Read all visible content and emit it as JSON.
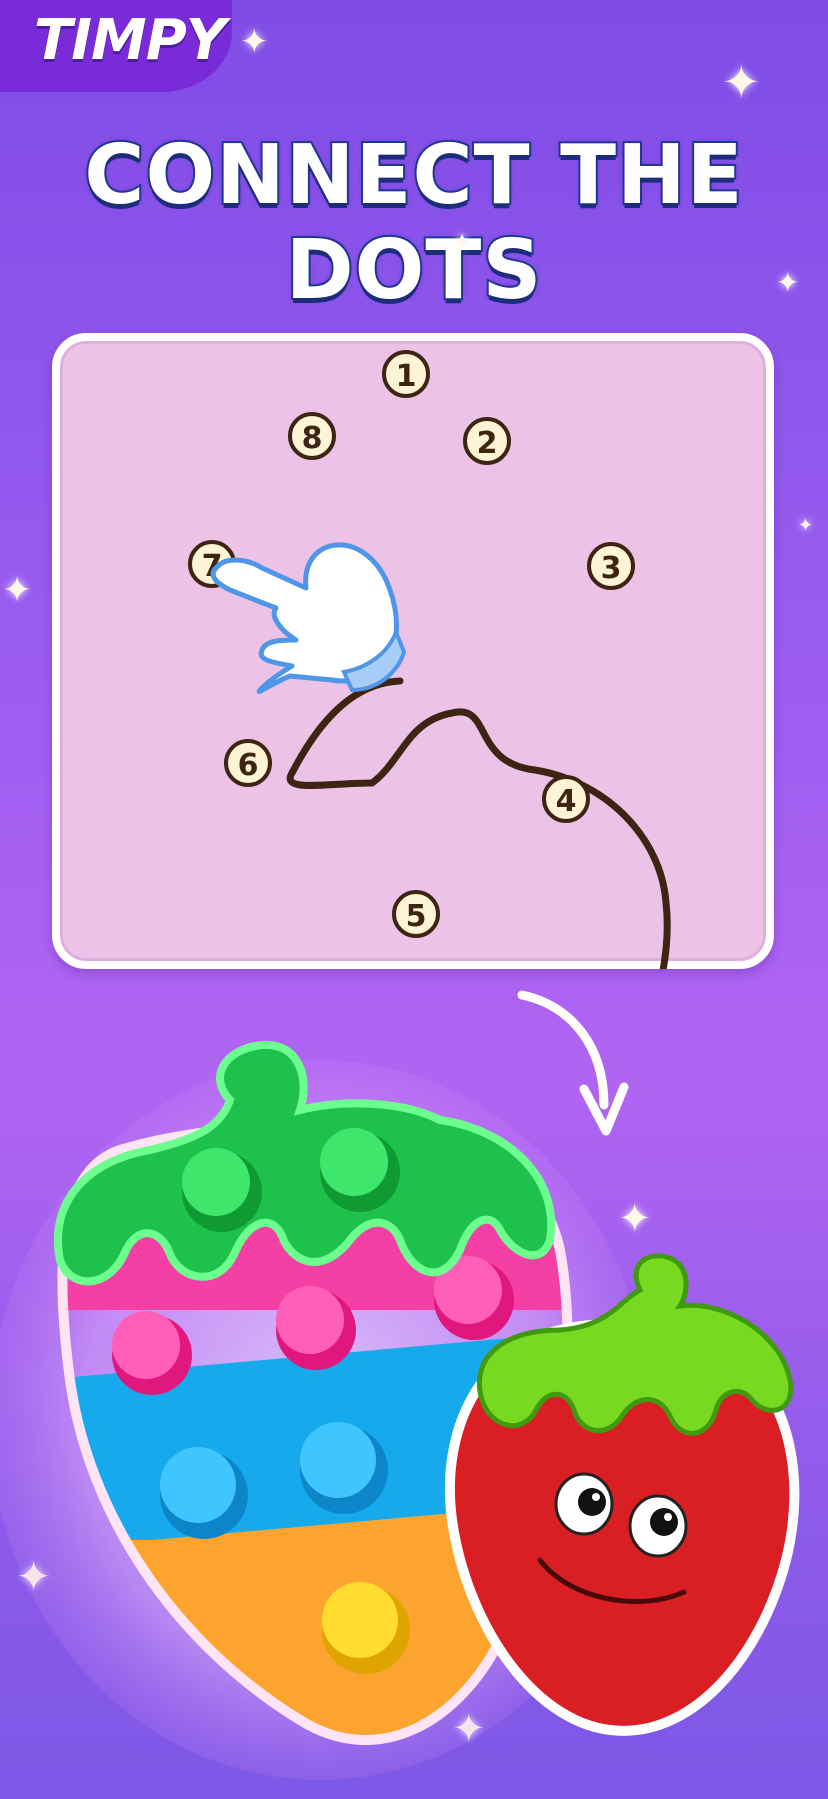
{
  "app": {
    "logo_text": "TIMPY"
  },
  "headline": "CONNECT THE DOTS",
  "puzzle": {
    "dots": [
      "1",
      "2",
      "3",
      "4",
      "5",
      "6",
      "7",
      "8"
    ]
  },
  "colors": {
    "background": "#9a5cf0",
    "title_outline": "#233a99",
    "panel_fill": "#ecc2e7",
    "line": "#3e2412",
    "dot_fill": "#fdf4d6"
  },
  "icons": [
    "hand-pointer-icon",
    "curved-arrow-icon",
    "sparkle-icon",
    "strawberry-popit-icon",
    "strawberry-character-icon"
  ]
}
